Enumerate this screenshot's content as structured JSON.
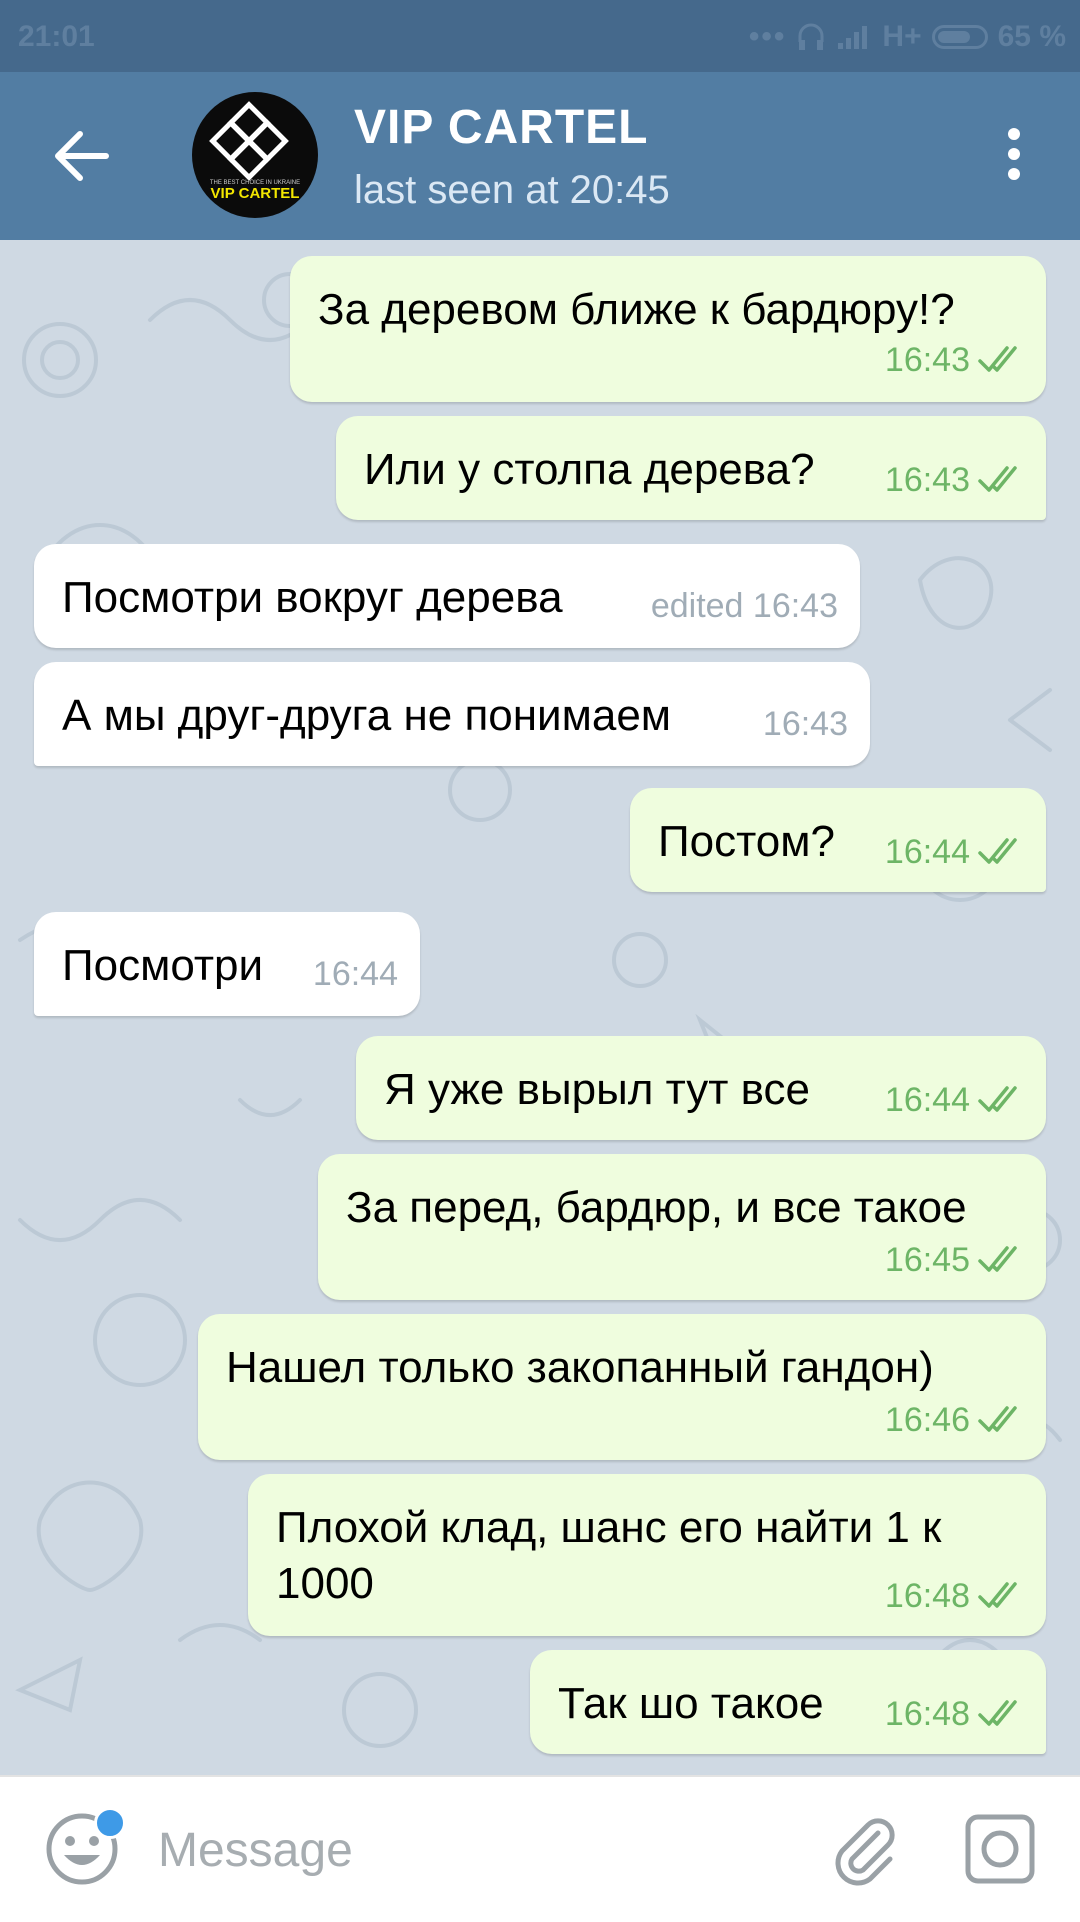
{
  "status_bar": {
    "time": "21:01",
    "network": "H+",
    "battery_percent": "65 %"
  },
  "header": {
    "title": "VIP CARTEL",
    "subtitle": "last seen at 20:45",
    "avatar_text": "VIP CARTEL",
    "avatar_tagline": "THE BEST CHOICE IN UKRAINE"
  },
  "messages": [
    {
      "dir": "out",
      "text": "За деревом ближе к бардюру!?",
      "time": "16:43",
      "status": "read"
    },
    {
      "dir": "out",
      "text": "Или у столпа дерева?",
      "time": "16:43",
      "status": "read"
    },
    {
      "dir": "in",
      "text": "Посмотри вокруг дерева",
      "time": "edited 16:43"
    },
    {
      "dir": "in",
      "text": "А мы друг-друга не понимаем",
      "time": "16:43"
    },
    {
      "dir": "out",
      "text": "Постом?",
      "time": "16:44",
      "status": "read"
    },
    {
      "dir": "in",
      "text": "Посмотри",
      "time": "16:44"
    },
    {
      "dir": "out",
      "text": "Я уже вырыл тут все",
      "time": "16:44",
      "status": "read"
    },
    {
      "dir": "out",
      "text": "За перед, бардюр, и все такое",
      "time": "16:45",
      "status": "read"
    },
    {
      "dir": "out",
      "text": "Нашел только закопанный гандон)",
      "time": "16:46",
      "status": "read"
    },
    {
      "dir": "out",
      "text": "Плохой клад, шанс его найти 1 к 1000",
      "text_line1": "Плохой клад, шанс его найти 1 к",
      "text_line2": "1000",
      "time": "16:48",
      "status": "read"
    },
    {
      "dir": "out",
      "text": "Так шо такое",
      "time": "16:48",
      "status": "read"
    }
  ],
  "input": {
    "placeholder": "Message"
  },
  "colors": {
    "header": "#527da3",
    "status_bar": "#45698c",
    "outgoing_bubble": "#effdde",
    "incoming_bubble": "#ffffff",
    "check_green": "#6db566"
  }
}
